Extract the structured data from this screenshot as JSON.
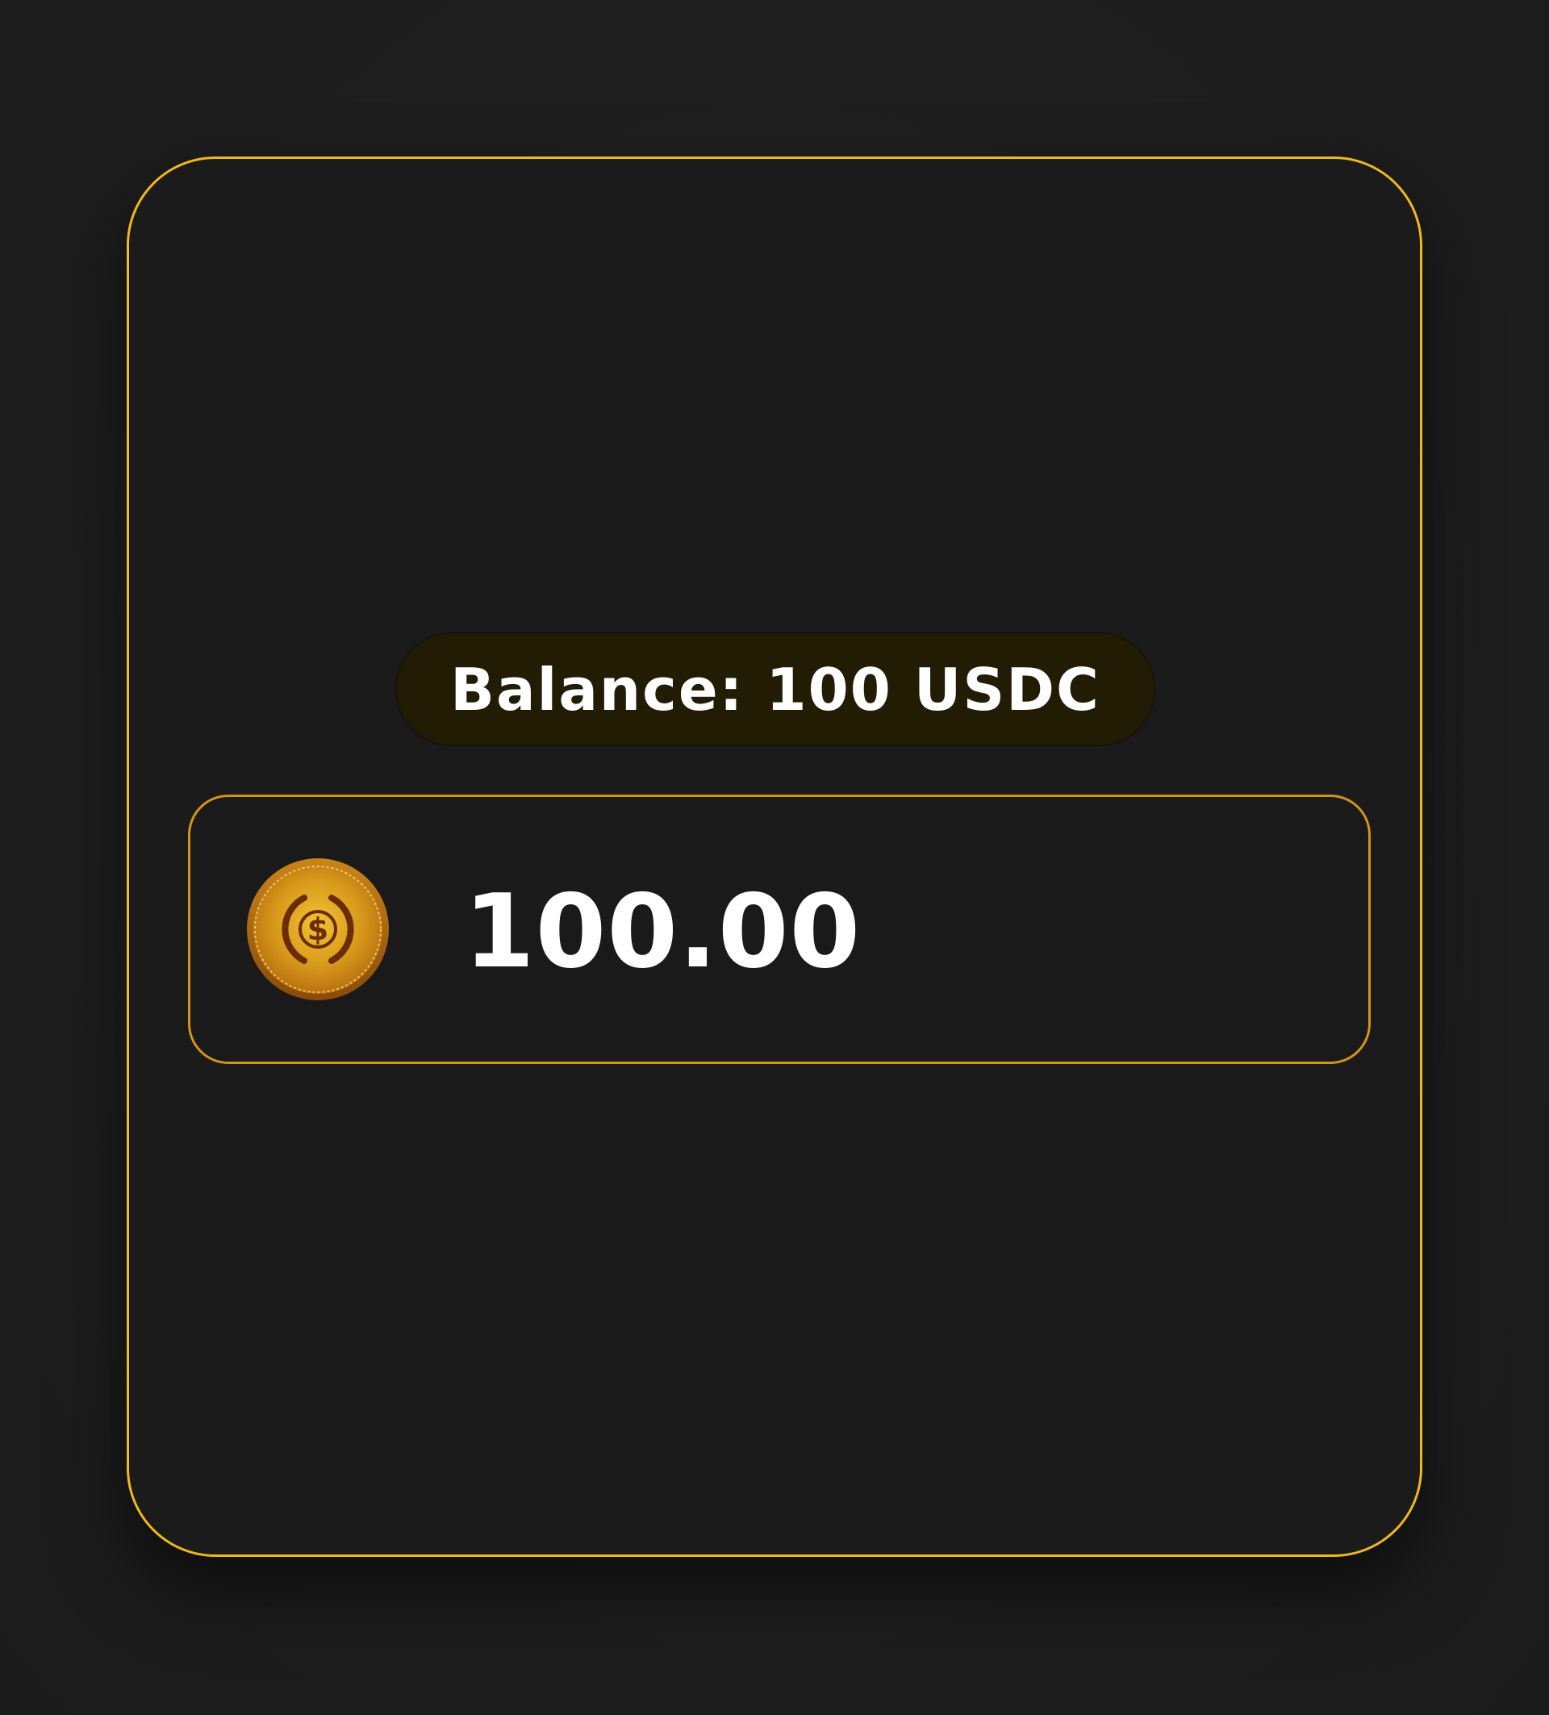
{
  "balance": {
    "text": "Balance: 100 USDC"
  },
  "amount_input": {
    "value": "100.00"
  },
  "token": {
    "icon": "usdc-coin-icon",
    "symbol_glyph": "$"
  },
  "colors": {
    "accent_gold": "#f0b81d",
    "field_border": "#d49318",
    "pill_background": "#221c05",
    "card_background": "#1b1b1b",
    "text": "#ffffff"
  }
}
